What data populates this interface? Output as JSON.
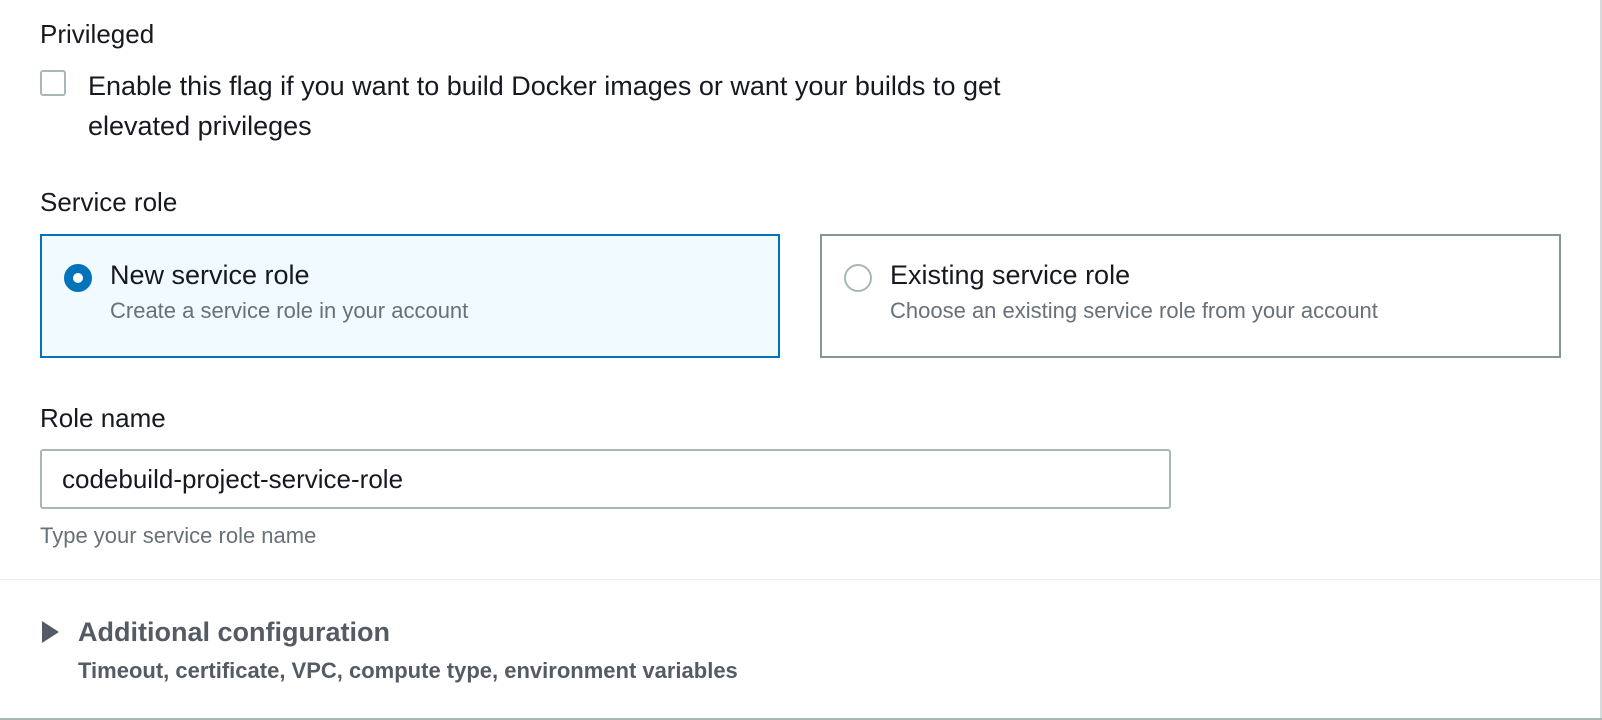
{
  "privileged": {
    "label": "Privileged",
    "checkbox_checked": false,
    "checkbox_text": "Enable this flag if you want to build Docker images or want your builds to get elevated privileges"
  },
  "service_role": {
    "label": "Service role",
    "options": [
      {
        "title": "New service role",
        "description": "Create a service role in your account",
        "selected": true
      },
      {
        "title": "Existing service role",
        "description": "Choose an existing service role from your account",
        "selected": false
      }
    ]
  },
  "role_name": {
    "label": "Role name",
    "value": "codebuild-project-service-role",
    "hint": "Type your service role name"
  },
  "additional_configuration": {
    "title": "Additional configuration",
    "description": "Timeout, certificate, VPC, compute type, environment variables",
    "expanded": false,
    "icon": "caret-right-icon"
  },
  "colors": {
    "accent": "#0073bb",
    "selected_tile_bg": "#f1faff",
    "border": "#aab7b8",
    "secondary_text": "#687078",
    "muted_heading": "#545b64"
  }
}
